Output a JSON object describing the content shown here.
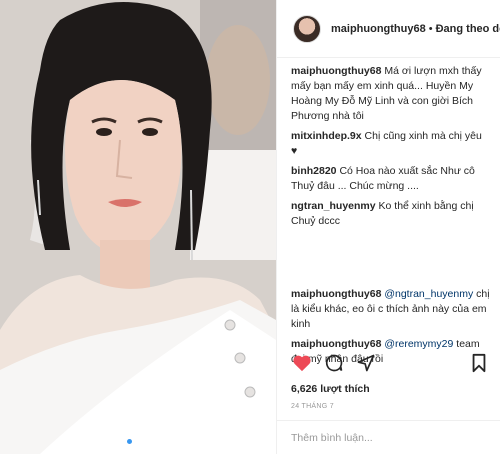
{
  "post": {
    "author": "maiphuongthuy68",
    "separator": "•",
    "follow_status": "Đang theo dõi",
    "carousel_pages": 3,
    "carousel_active": 1
  },
  "comments": [
    {
      "user": "maiphuongthuy68",
      "text": "Má ơi lượn mxh thấy mấy bạn mấy em xinh quá... Huyền My Hoàng My Đỗ Mỹ Linh và con giời Bích Phương nhà tôi"
    },
    {
      "user": "mitxinhdep.9x",
      "text": "Chị cũng xinh mà chị yêu ♥"
    },
    {
      "user": "binh2820",
      "text": "Có Hoa nào xuất sắc Như cô Thuỷ đâu ... Chúc mừng ...."
    },
    {
      "user": "ngtran_huyenmy",
      "text": "Ko thể xinh bằng chị Chuỷ dccc"
    },
    {
      "user": "maiphuongthuy68",
      "mention": "@ngtran_huyenmy",
      "text": "chị là kiểu khác, eo ôi c thích ảnh này của em kinh"
    },
    {
      "user": "maiphuongthuy68",
      "mention": "@reremymy29",
      "text": "team đại mỹ nhân đâu rồi"
    }
  ],
  "likes_text": "6,626 lượt thích",
  "date_text": "24 THÁNG 7",
  "comment_input": {
    "placeholder": "Thêm bình luận...",
    "value": ""
  },
  "icons": [
    "heart-icon",
    "comment-icon",
    "share-icon",
    "bookmark-icon"
  ],
  "colors": {
    "like": "#ed4956",
    "mention": "#003569",
    "active_dot": "#3897f0"
  }
}
